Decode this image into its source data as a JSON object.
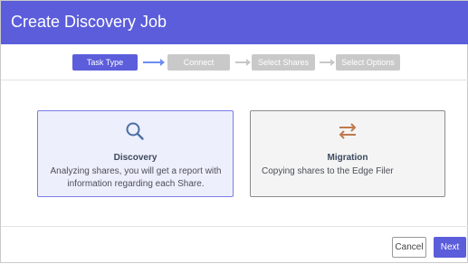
{
  "dialog": {
    "title": "Create Discovery Job"
  },
  "stepper": {
    "steps": [
      {
        "label": "Task Type",
        "active": true
      },
      {
        "label": "Connect",
        "active": false
      },
      {
        "label": "Select Shares",
        "active": false
      },
      {
        "label": "Select Options",
        "active": false
      }
    ]
  },
  "cards": {
    "discovery": {
      "icon": "search-icon",
      "title": "Discovery",
      "desc_line1": "Analyzing shares, you will get a report with",
      "desc_line2": "information regarding each Share.",
      "selected": true
    },
    "migration": {
      "icon": "transfer-arrows-icon",
      "title": "Migration",
      "desc_line1": "Copying shares to the Edge Filer",
      "selected": false
    }
  },
  "footer": {
    "cancel_label": "Cancel",
    "next_label": "Next"
  },
  "colors": {
    "header": "#5b5ddb",
    "active_step": "#5b5ddb",
    "inactive_step": "#c9c9c9",
    "discovery_icon": "#4a6fa5",
    "migration_icon": "#c0794f"
  }
}
